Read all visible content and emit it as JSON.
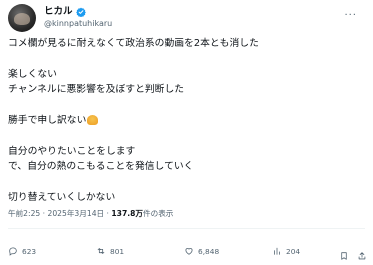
{
  "author": {
    "display_name": "ヒカル",
    "handle": "@kinnpatuhikaru"
  },
  "more_label": "···",
  "tweet": {
    "lines": [
      "コメ欄が見るに耐えなくて政治系の動画を2本とも消した",
      "",
      "楽しくない",
      "チャンネルに悪影響を及ぼすと判断した",
      "",
      "勝手で申し訳ない",
      "",
      "自分のやりたいことをします",
      "で、自分の熱のこもることを発信していく",
      "",
      "切り替えていくしかない"
    ]
  },
  "meta": {
    "time": "午前2:25",
    "date": "2025年3月14日",
    "views_count": "137.8万",
    "views_label": "件の表示",
    "sep": "·"
  },
  "actions": {
    "replies": "623",
    "retweets": "801",
    "likes": "6,848",
    "bookmarks": "204"
  },
  "colors": {
    "text": "#0f1419",
    "secondary": "#536471",
    "verified": "#1d9bf0"
  }
}
